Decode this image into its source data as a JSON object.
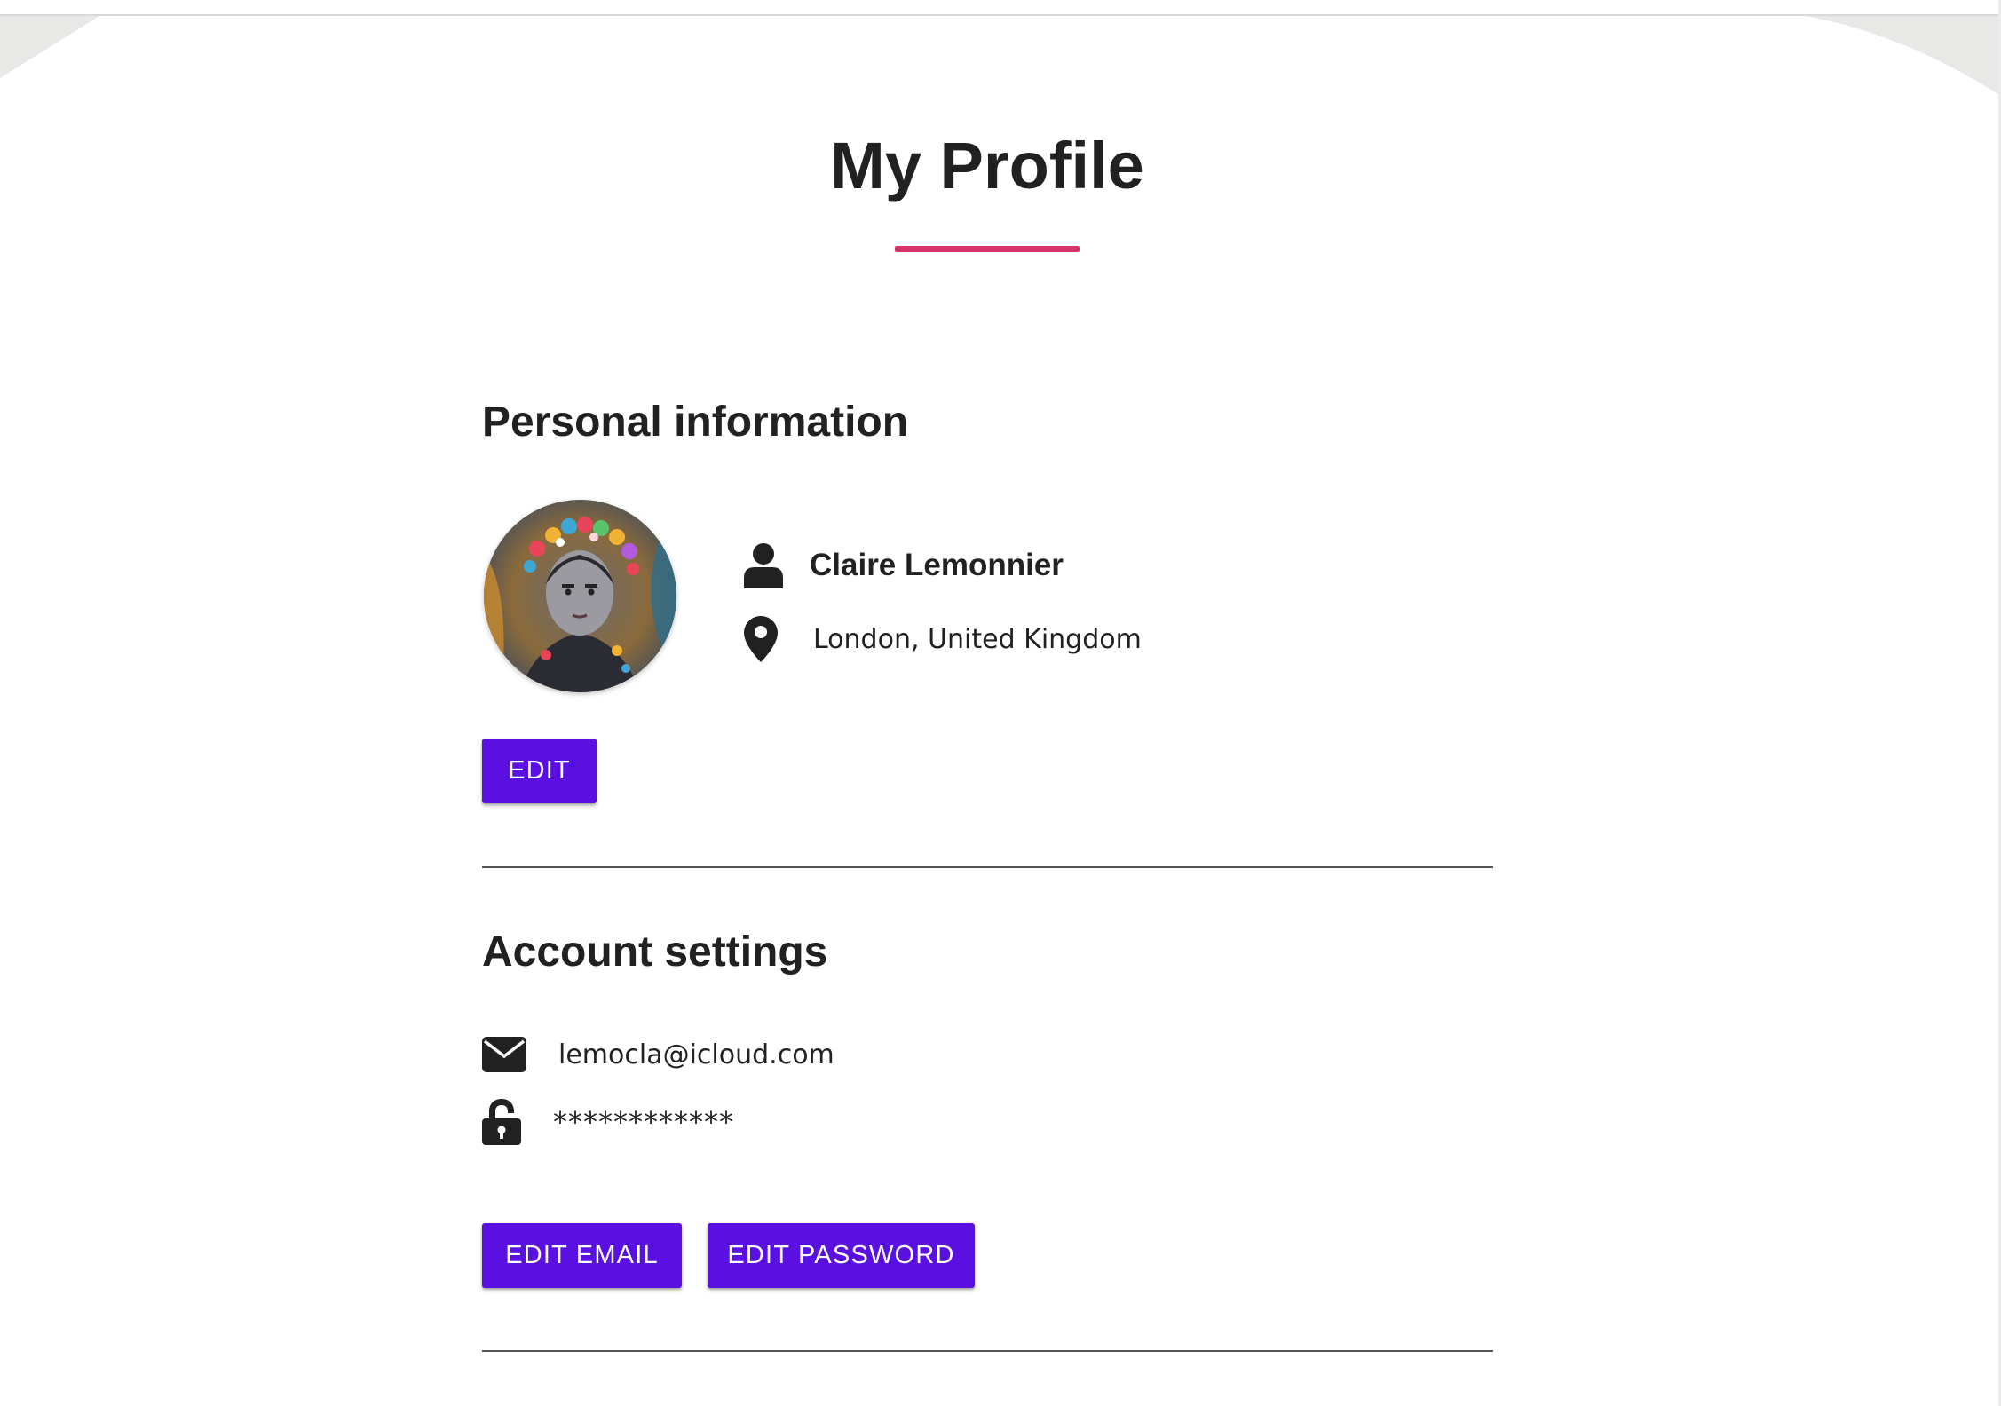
{
  "page": {
    "title": "My Profile"
  },
  "personal": {
    "heading": "Personal information",
    "name": "Claire Lemonnier",
    "location": "London, United Kingdom",
    "edit_label": "EDIT"
  },
  "account": {
    "heading": "Account settings",
    "email": "lemocla@icloud.com",
    "password": "************",
    "edit_email_label": "EDIT EMAIL",
    "edit_password_label": "EDIT PASSWORD"
  },
  "icons": {
    "name": "user-icon",
    "location": "map-marker-icon",
    "email": "envelope-icon",
    "password": "unlock-icon"
  },
  "colors": {
    "accent": "#d6336c",
    "button": "#5a10e0",
    "text": "#212121"
  }
}
